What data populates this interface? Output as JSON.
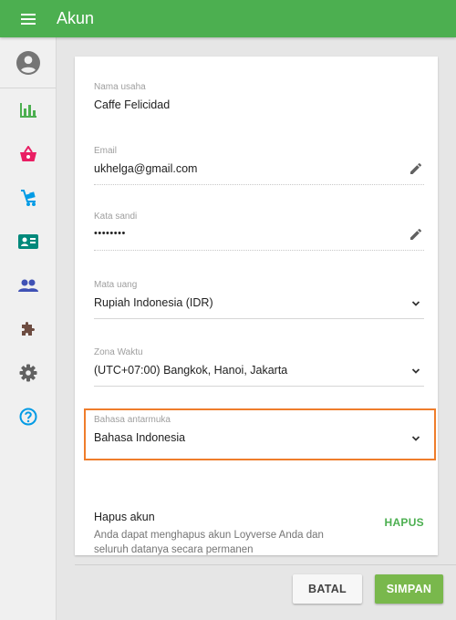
{
  "header": {
    "title": "Akun"
  },
  "sidebar": {
    "items": [
      {
        "icon": "bar-chart-icon",
        "color": "#4caf50"
      },
      {
        "icon": "basket-icon",
        "color": "#e91e63"
      },
      {
        "icon": "cart-icon",
        "color": "#039be5"
      },
      {
        "icon": "id-card-icon",
        "color": "#00897b"
      },
      {
        "icon": "people-icon",
        "color": "#3f51b5"
      },
      {
        "icon": "puzzle-icon",
        "color": "#6d4c41"
      },
      {
        "icon": "gear-icon",
        "color": "#616161"
      },
      {
        "icon": "help-icon",
        "color": "#039be5"
      }
    ]
  },
  "form": {
    "business_name": {
      "label": "Nama usaha",
      "value": "Caffe Felicidad"
    },
    "email": {
      "label": "Email",
      "value": "ukhelga@gmail.com"
    },
    "password": {
      "label": "Kata sandi",
      "value": "••••••••"
    },
    "currency": {
      "label": "Mata uang",
      "value": "Rupiah Indonesia (IDR)"
    },
    "timezone": {
      "label": "Zona Waktu",
      "value": "(UTC+07:00) Bangkok, Hanoi, Jakarta"
    },
    "language": {
      "label": "Bahasa antarmuka",
      "value": "Bahasa Indonesia"
    }
  },
  "delete_account": {
    "title": "Hapus akun",
    "description": "Anda dapat menghapus akun Loyverse Anda dan seluruh datanya secara permanen",
    "button": "HAPUS"
  },
  "actions": {
    "cancel": "BATAL",
    "save": "SIMPAN"
  },
  "colors": {
    "primary": "#4caf50",
    "highlight": "#ef7d2b"
  }
}
